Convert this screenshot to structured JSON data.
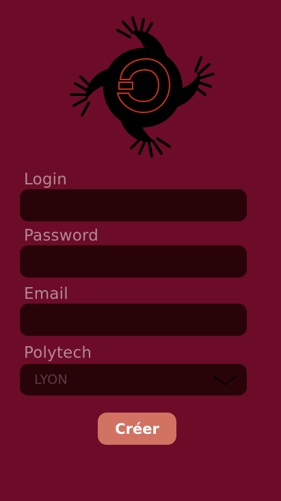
{
  "logo": {
    "icon": "spiral-claw-logo-icon"
  },
  "form": {
    "login": {
      "label": "Login",
      "value": ""
    },
    "password": {
      "label": "Password",
      "value": ""
    },
    "email": {
      "label": "Email",
      "value": ""
    },
    "polytech": {
      "label": "Polytech",
      "selected": "LYON"
    },
    "submit_label": "Créer"
  },
  "colors": {
    "background": "#6d0c28",
    "field_background": "#280409",
    "label_text": "#b08a94",
    "button_background": "#d27262"
  }
}
